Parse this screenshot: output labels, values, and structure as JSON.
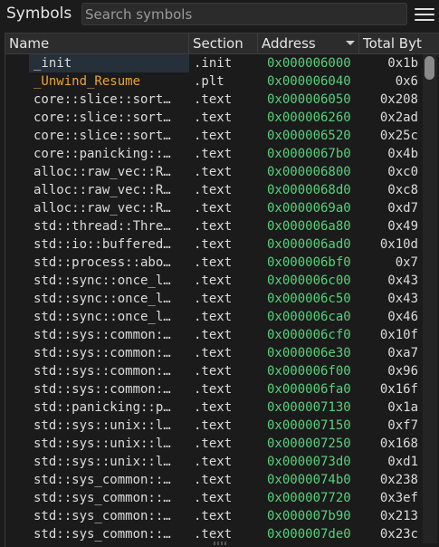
{
  "header": {
    "title": "Symbols",
    "search_placeholder": "Search symbols"
  },
  "columns": {
    "name": "Name",
    "section": "Section",
    "address": "Address",
    "total": "Total Byt"
  },
  "colors": {
    "address": "#57d17a",
    "plt_name": "#f0a233",
    "selected_bg": "#26303a"
  },
  "rows": [
    {
      "name": "_init",
      "section": ".init",
      "address": "0x000006000",
      "total": "0x1b"
    },
    {
      "name": "_Unwind_Resume",
      "section": ".plt",
      "address": "0x000006040",
      "total": "0x6"
    },
    {
      "name": "core::slice::sort…",
      "section": ".text",
      "address": "0x000006050",
      "total": "0x208"
    },
    {
      "name": "core::slice::sort…",
      "section": ".text",
      "address": "0x000006260",
      "total": "0x2ad"
    },
    {
      "name": "core::slice::sort…",
      "section": ".text",
      "address": "0x000006520",
      "total": "0x25c"
    },
    {
      "name": "core::panicking::…",
      "section": ".text",
      "address": "0x0000067b0",
      "total": "0x4b"
    },
    {
      "name": "alloc::raw_vec::R…",
      "section": ".text",
      "address": "0x000006800",
      "total": "0xc0"
    },
    {
      "name": "alloc::raw_vec::R…",
      "section": ".text",
      "address": "0x0000068d0",
      "total": "0xc8"
    },
    {
      "name": "alloc::raw_vec::R…",
      "section": ".text",
      "address": "0x0000069a0",
      "total": "0xd7"
    },
    {
      "name": "std::thread::Thre…",
      "section": ".text",
      "address": "0x000006a80",
      "total": "0x49"
    },
    {
      "name": "std::io::buffered…",
      "section": ".text",
      "address": "0x000006ad0",
      "total": "0x10d"
    },
    {
      "name": "std::process::abo…",
      "section": ".text",
      "address": "0x000006bf0",
      "total": "0x7"
    },
    {
      "name": "std::sync::once_l…",
      "section": ".text",
      "address": "0x000006c00",
      "total": "0x43"
    },
    {
      "name": "std::sync::once_l…",
      "section": ".text",
      "address": "0x000006c50",
      "total": "0x43"
    },
    {
      "name": "std::sync::once_l…",
      "section": ".text",
      "address": "0x000006ca0",
      "total": "0x46"
    },
    {
      "name": "std::sys::common:…",
      "section": ".text",
      "address": "0x000006cf0",
      "total": "0x10f"
    },
    {
      "name": "std::sys::common:…",
      "section": ".text",
      "address": "0x000006e30",
      "total": "0xa7"
    },
    {
      "name": "std::sys::common:…",
      "section": ".text",
      "address": "0x000006f00",
      "total": "0x96"
    },
    {
      "name": "std::sys::common:…",
      "section": ".text",
      "address": "0x000006fa0",
      "total": "0x16f"
    },
    {
      "name": "std::panicking::p…",
      "section": ".text",
      "address": "0x000007130",
      "total": "0x1a"
    },
    {
      "name": "std::sys::unix::l…",
      "section": ".text",
      "address": "0x000007150",
      "total": "0xf7"
    },
    {
      "name": "std::sys::unix::l…",
      "section": ".text",
      "address": "0x000007250",
      "total": "0x168"
    },
    {
      "name": "std::sys::unix::l…",
      "section": ".text",
      "address": "0x0000073d0",
      "total": "0xd1"
    },
    {
      "name": "std::sys_common::…",
      "section": ".text",
      "address": "0x0000074b0",
      "total": "0x238"
    },
    {
      "name": "std::sys_common::…",
      "section": ".text",
      "address": "0x000007720",
      "total": "0x3ef"
    },
    {
      "name": "std::sys_common::…",
      "section": ".text",
      "address": "0x000007b90",
      "total": "0x213"
    },
    {
      "name": "std::sys_common::…",
      "section": ".text",
      "address": "0x000007de0",
      "total": "0x23c"
    }
  ]
}
